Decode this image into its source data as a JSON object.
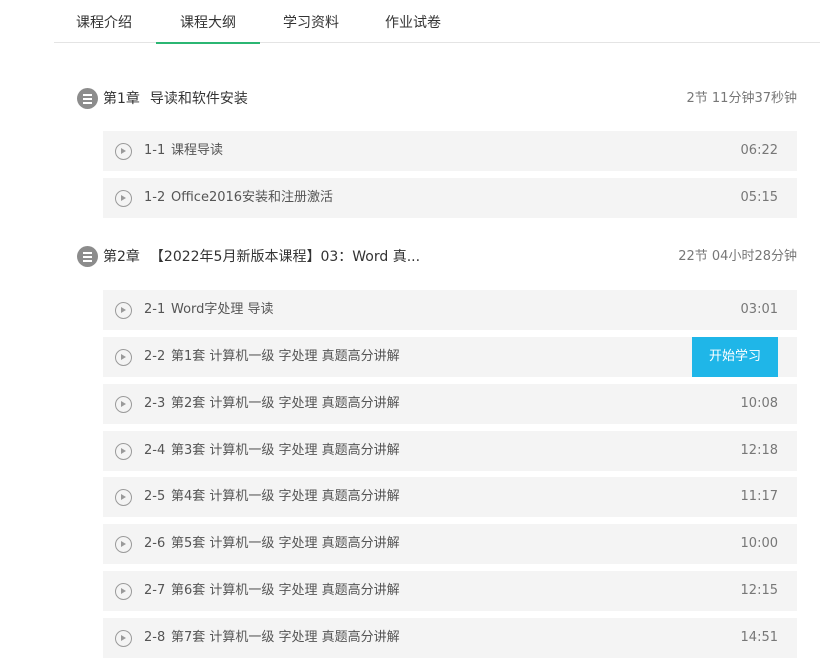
{
  "tabs": [
    {
      "label": "课程介绍"
    },
    {
      "label": "课程大纲"
    },
    {
      "label": "学习资料"
    },
    {
      "label": "作业试卷"
    }
  ],
  "active_tab": "课程大纲",
  "accent_color": "#2bb673",
  "button_color": "#1fb6e8",
  "chapters": [
    {
      "number": "第1章",
      "title": "导读和软件安装",
      "meta": "2节 11分钟37秒钟",
      "lessons": [
        {
          "no": "1-1",
          "title": "课程导读",
          "duration": "06:22"
        },
        {
          "no": "1-2",
          "title": "Office2016安装和注册激活",
          "duration": "05:15"
        }
      ]
    },
    {
      "number": "第2章",
      "title": "【2022年5月新版本课程】03：Word 真...",
      "meta": "22节 04小时28分钟",
      "lessons": [
        {
          "no": "2-1",
          "title": "Word字处理 导读",
          "duration": "03:01"
        },
        {
          "no": "2-2",
          "title": "第1套 计算机一级 字处理 真题高分讲解",
          "button": "开始学习"
        },
        {
          "no": "2-3",
          "title": "第2套 计算机一级 字处理 真题高分讲解",
          "duration": "10:08"
        },
        {
          "no": "2-4",
          "title": "第3套 计算机一级 字处理 真题高分讲解",
          "duration": "12:18"
        },
        {
          "no": "2-5",
          "title": "第4套 计算机一级 字处理 真题高分讲解",
          "duration": "11:17"
        },
        {
          "no": "2-6",
          "title": "第5套 计算机一级 字处理 真题高分讲解",
          "duration": "10:00"
        },
        {
          "no": "2-7",
          "title": "第6套 计算机一级 字处理 真题高分讲解",
          "duration": "12:15"
        },
        {
          "no": "2-8",
          "title": "第7套 计算机一级 字处理 真题高分讲解",
          "duration": "14:51"
        }
      ]
    }
  ]
}
